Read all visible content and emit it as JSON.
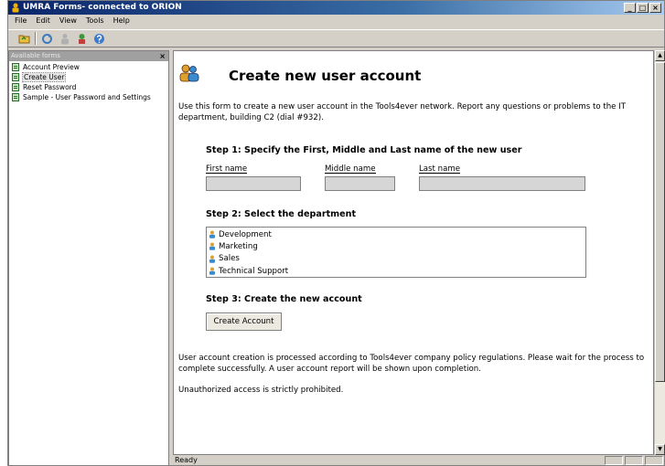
{
  "window": {
    "title": "UMRA Forms- connected to ORION",
    "controls": [
      "_",
      "□",
      "×"
    ]
  },
  "menu": [
    "File",
    "Edit",
    "View",
    "Tools",
    "Help"
  ],
  "toolbar": {
    "icons": [
      "open-folder-icon",
      "refresh-icon",
      "user-icon",
      "network-icon",
      "help-icon"
    ]
  },
  "sidebar": {
    "header": "Available forms",
    "close_label": "×",
    "items": [
      {
        "label": "Account Preview"
      },
      {
        "label": "Create User",
        "selected": true
      },
      {
        "label": "Reset Password"
      },
      {
        "label": "Sample - User Password and Settings"
      }
    ]
  },
  "form": {
    "title": "Create new user account",
    "intro": "Use this form to create a new user account in the Tools4ever network. Report any questions or problems to the IT department, building C2 (dial #932).",
    "step1": {
      "title": "Step 1: Specify the First, Middle and Last name of the new user",
      "first_name_label": "First name",
      "first_name_value": "",
      "middle_name_label": "Middle name",
      "middle_name_value": "",
      "last_name_label": "Last name",
      "last_name_value": ""
    },
    "step2": {
      "title": "Step 2: Select the department",
      "departments": [
        "Development",
        "Marketing",
        "Sales",
        "Technical Support"
      ]
    },
    "step3": {
      "title": "Step 3: Create the new account",
      "button_label": "Create Account"
    },
    "policy_text": "User account creation is processed according to Tools4ever company policy regulations. Please wait for the process to complete successfully. A user account report will be shown upon completion.",
    "warning_text": "Unauthorized access is strictly prohibited."
  },
  "status": {
    "text": "Ready"
  },
  "colors": {
    "title_bar": "#0a246a",
    "window_face": "#d4d0c8",
    "input_fill": "#d6d6d6"
  }
}
